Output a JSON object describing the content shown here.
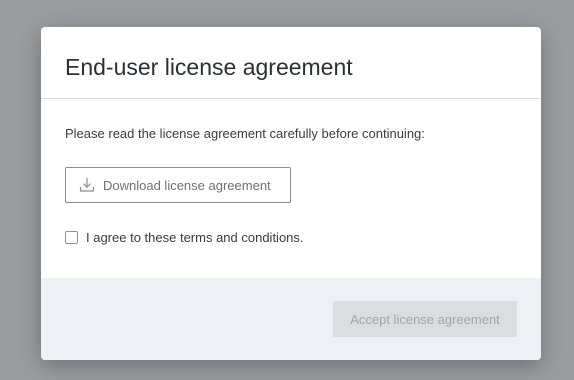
{
  "dialog": {
    "title": "End-user license agreement",
    "instructions": "Please read the license agreement carefully before continuing:",
    "download_button": {
      "label": "Download license agreement",
      "icon": "download-icon"
    },
    "agree_checkbox": {
      "label": "I agree to these terms and conditions.",
      "checked": false
    },
    "accept_button": {
      "label": "Accept license agreement",
      "disabled": true
    }
  },
  "colors": {
    "overlay": "#9b9c9f",
    "footer_bg": "#eef0f5",
    "disabled_button_bg": "#dcdde0",
    "disabled_button_text": "#a2a4a8"
  }
}
